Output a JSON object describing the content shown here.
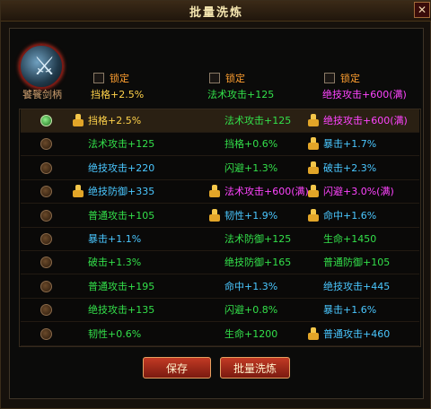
{
  "window": {
    "title": "批量洗炼",
    "close_label": "✕"
  },
  "weapon": {
    "name": "饕餮剑柄",
    "icon": "sword-icon"
  },
  "lock_label": "锁定",
  "current": [
    {
      "text": "挡格+2.5%",
      "color": "#ffd24a"
    },
    {
      "text": "法术攻击+125",
      "color": "#33e04a"
    },
    {
      "text": "绝技攻击+600(满)",
      "color": "#ff44ff"
    }
  ],
  "colors": {
    "yellow": "#ffd24a",
    "green": "#33e04a",
    "cyan": "#4ac7ff",
    "magenta": "#ff44ff"
  },
  "rows": [
    {
      "selected": true,
      "c1": {
        "text": "挡格+2.5%",
        "color": "#ffd24a",
        "thumb": true
      },
      "c2": {
        "text": "法术攻击+125",
        "color": "#33e04a",
        "thumb": false
      },
      "c3": {
        "text": "绝技攻击+600(满)",
        "color": "#ff44ff",
        "thumb": true
      }
    },
    {
      "selected": false,
      "c1": {
        "text": "法术攻击+125",
        "color": "#33e04a",
        "thumb": false
      },
      "c2": {
        "text": "挡格+0.6%",
        "color": "#33e04a",
        "thumb": false
      },
      "c3": {
        "text": "暴击+1.7%",
        "color": "#4ac7ff",
        "thumb": true
      }
    },
    {
      "selected": false,
      "c1": {
        "text": "绝技攻击+220",
        "color": "#4ac7ff",
        "thumb": false
      },
      "c2": {
        "text": "闪避+1.3%",
        "color": "#33e04a",
        "thumb": false
      },
      "c3": {
        "text": "破击+2.3%",
        "color": "#4ac7ff",
        "thumb": true
      }
    },
    {
      "selected": false,
      "c1": {
        "text": "绝技防御+335",
        "color": "#4ac7ff",
        "thumb": true
      },
      "c2": {
        "text": "法术攻击+600(满)",
        "color": "#ff44ff",
        "thumb": true
      },
      "c3": {
        "text": "闪避+3.0%(满)",
        "color": "#ff44ff",
        "thumb": true
      }
    },
    {
      "selected": false,
      "c1": {
        "text": "普通攻击+105",
        "color": "#33e04a",
        "thumb": false
      },
      "c2": {
        "text": "韧性+1.9%",
        "color": "#4ac7ff",
        "thumb": true
      },
      "c3": {
        "text": "命中+1.6%",
        "color": "#4ac7ff",
        "thumb": true
      }
    },
    {
      "selected": false,
      "c1": {
        "text": "暴击+1.1%",
        "color": "#4ac7ff",
        "thumb": false
      },
      "c2": {
        "text": "法术防御+125",
        "color": "#33e04a",
        "thumb": false
      },
      "c3": {
        "text": "生命+1450",
        "color": "#33e04a",
        "thumb": false
      }
    },
    {
      "selected": false,
      "c1": {
        "text": "破击+1.3%",
        "color": "#33e04a",
        "thumb": false
      },
      "c2": {
        "text": "绝技防御+165",
        "color": "#33e04a",
        "thumb": false
      },
      "c3": {
        "text": "普通防御+105",
        "color": "#33e04a",
        "thumb": false
      }
    },
    {
      "selected": false,
      "c1": {
        "text": "普通攻击+195",
        "color": "#33e04a",
        "thumb": false
      },
      "c2": {
        "text": "命中+1.3%",
        "color": "#4ac7ff",
        "thumb": false
      },
      "c3": {
        "text": "绝技攻击+445",
        "color": "#4ac7ff",
        "thumb": false
      }
    },
    {
      "selected": false,
      "c1": {
        "text": "绝技攻击+135",
        "color": "#33e04a",
        "thumb": false
      },
      "c2": {
        "text": "闪避+0.8%",
        "color": "#33e04a",
        "thumb": false
      },
      "c3": {
        "text": "暴击+1.6%",
        "color": "#4ac7ff",
        "thumb": false
      }
    },
    {
      "selected": false,
      "c1": {
        "text": "韧性+0.6%",
        "color": "#33e04a",
        "thumb": false
      },
      "c2": {
        "text": "生命+1200",
        "color": "#33e04a",
        "thumb": false
      },
      "c3": {
        "text": "普通攻击+460",
        "color": "#4ac7ff",
        "thumb": true
      }
    }
  ],
  "buttons": {
    "save": "保存",
    "batch": "批量洗炼"
  }
}
